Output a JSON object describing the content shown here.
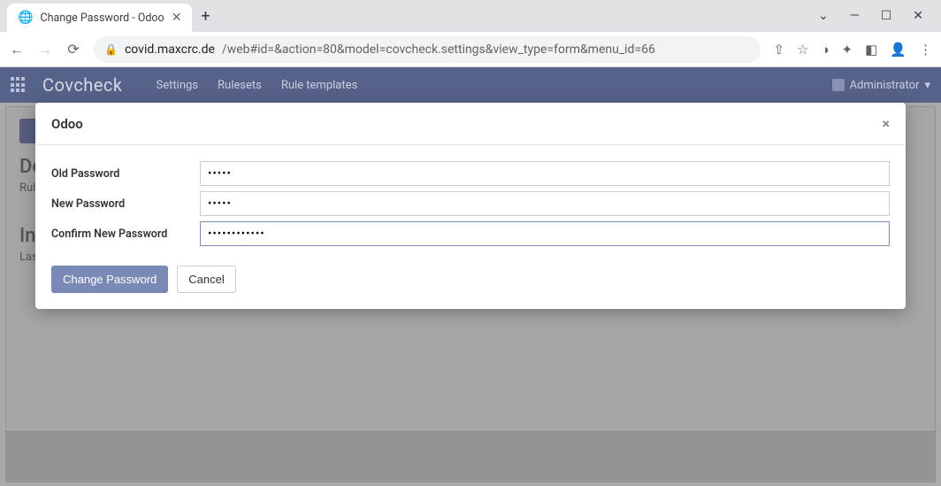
{
  "browser": {
    "tab_title": "Change Password - Odoo",
    "url_host": "covid.maxcrc.de",
    "url_path": "/web#id=&action=80&model=covcheck.settings&view_type=form&menu_id=66"
  },
  "nav": {
    "brand": "Covcheck",
    "links": [
      "Settings",
      "Rulesets",
      "Rule templates"
    ],
    "user": "Administrator"
  },
  "page": {
    "section1": "De",
    "rule_label": "Rul",
    "section2": "Inf",
    "last_label": "Las"
  },
  "modal": {
    "title": "Odoo",
    "fields": {
      "old_password": {
        "label": "Old Password",
        "value": "•••••"
      },
      "new_password": {
        "label": "New Password",
        "value": "•••••"
      },
      "confirm_password": {
        "label": "Confirm New Password",
        "value": "••••••••••••"
      }
    },
    "buttons": {
      "primary": "Change Password",
      "cancel": "Cancel"
    }
  }
}
